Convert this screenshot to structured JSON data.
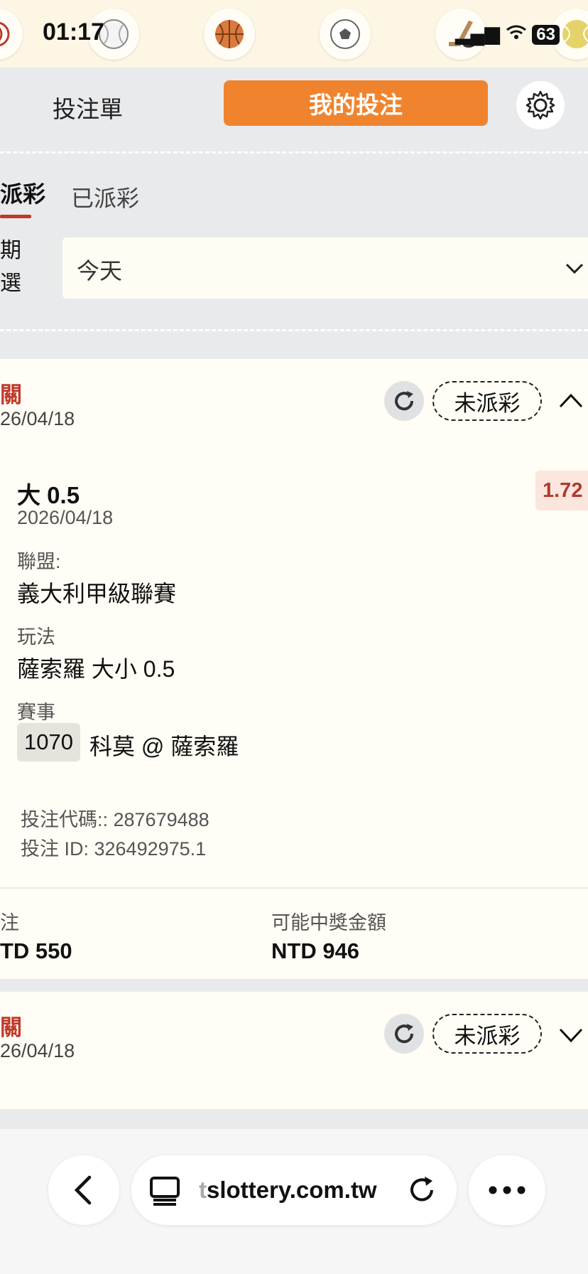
{
  "status_bar": {
    "time": "01:17",
    "battery": "63"
  },
  "sport_icons": [
    "baseball-icon",
    "basketball-icon",
    "soccer-icon",
    "hockey-icon",
    "tennis-icon"
  ],
  "header": {
    "betslip_label": "投注單",
    "mybets_label": "我的投注",
    "accent": "#f0842e"
  },
  "subtabs": {
    "active_label": "派彩",
    "other_label": "已派彩"
  },
  "filter": {
    "label_line1": "期",
    "label_line2": "選",
    "date_value": "今天"
  },
  "bets": [
    {
      "type": "關",
      "date": "26/04/18",
      "status": "未派彩",
      "selection": "大 0.5",
      "selection_date": "2026/04/18",
      "odds": "1.72",
      "league_label": "聯盟:",
      "league": "義大利甲級聯賽",
      "market_label": "玩法",
      "market": "薩索羅 大小 0.5",
      "event_label": "賽事",
      "event_id": "1070",
      "event": "科莫 @ 薩索羅",
      "code": "投注代碼:: 287679488",
      "bet_id": "投注 ID: 326492975.1",
      "stake_label": "注",
      "stake": "TD 550",
      "potential_label": "可能中獎金額",
      "potential": "NTD 946"
    },
    {
      "type": "關",
      "date": "26/04/18",
      "status": "未派彩"
    }
  ],
  "browser": {
    "url_faded": "t",
    "url": "slottery.com.tw"
  }
}
